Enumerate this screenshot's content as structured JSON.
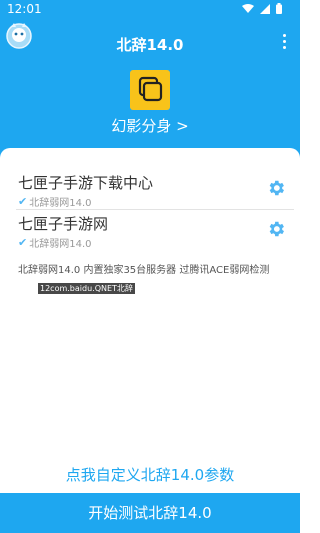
{
  "status_bar": {
    "time": "12:01"
  },
  "app_bar": {
    "title": "北辞14.0"
  },
  "feature": {
    "label": "幻影分身 >"
  },
  "list": [
    {
      "title": "七匣子手游下载中心",
      "subtitle": "北辞弱网14.0"
    },
    {
      "title": "七匣子手游网",
      "subtitle": "北辞弱网14.0"
    }
  ],
  "info": "北辞弱网14.0 内置独家35台服务器 过腾讯ACE弱网检测",
  "watermark": "12com.baidu.QNET北辞",
  "custom_link": "点我自定义北辞14.0参数",
  "bottom_button": "开始测试北辞14.0",
  "colors": {
    "primary": "#1ea7f0",
    "accent": "#f8c31a",
    "check": "#52b6f3"
  }
}
